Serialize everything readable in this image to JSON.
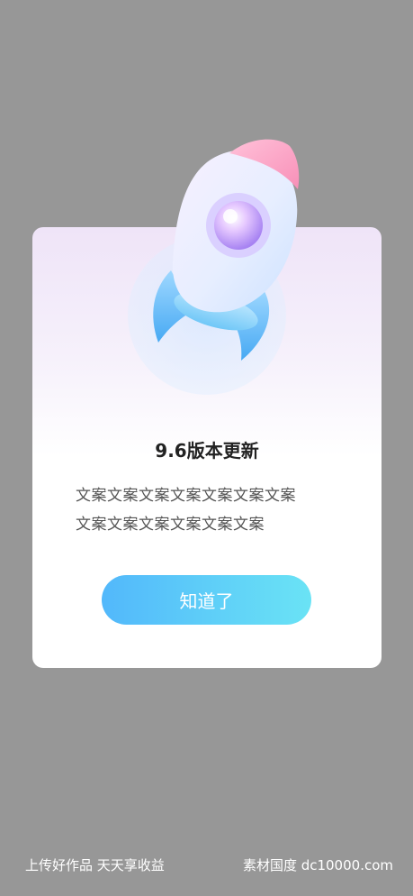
{
  "dialog": {
    "title": "9.6版本更新",
    "body_lines": [
      "文案文案文案文案文案文案文案",
      "文案文案文案文案文案文案"
    ],
    "button_label": "知道了",
    "illustration": "rocket-icon"
  },
  "footer": {
    "left_text": "上传好作品 天天享收益",
    "right_text": "素材国度 dc10000.com"
  },
  "colors": {
    "background": "#979797",
    "button_start": "#52b8fb",
    "button_end": "#6ae3f5"
  }
}
